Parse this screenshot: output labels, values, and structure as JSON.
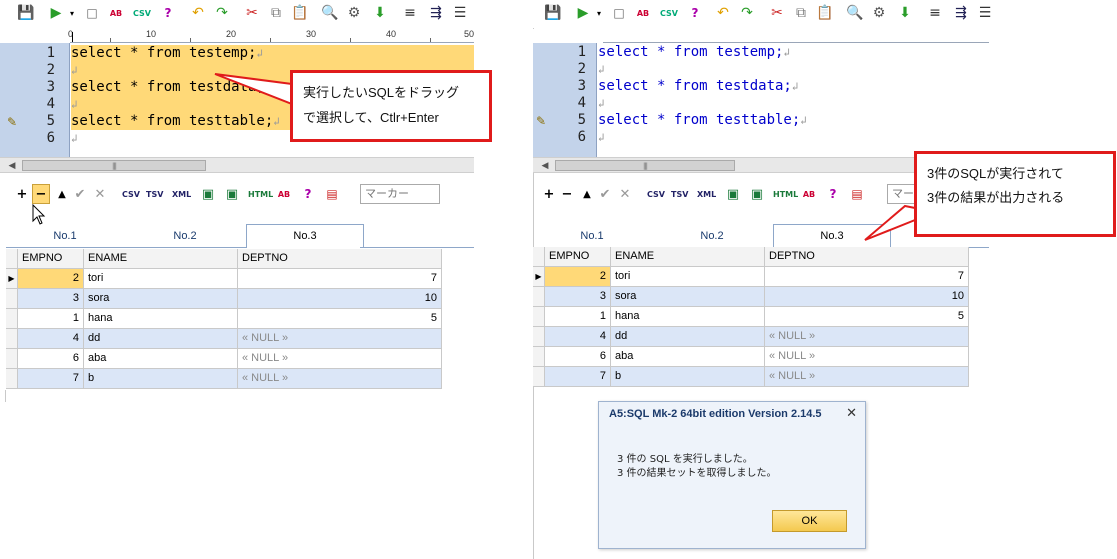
{
  "editor": {
    "lines_left": [
      {
        "num": "1",
        "code": "select * from testemp;"
      },
      {
        "num": "2",
        "code": ""
      },
      {
        "num": "3",
        "code": "select * from testdata;"
      },
      {
        "num": "4",
        "code": ""
      },
      {
        "num": "5",
        "code": "select * from testtable;"
      },
      {
        "num": "6",
        "code": ""
      }
    ],
    "eol_mark": "↲",
    "ruler_labels": [
      "0",
      "10",
      "20",
      "30",
      "40",
      "50"
    ]
  },
  "grid_toolbar": {
    "marker_placeholder": "マーカー",
    "marker_placeholder_right": "マー"
  },
  "result_tabs": [
    "No.1",
    "No.2",
    "No.3"
  ],
  "active_tab": "No.3",
  "grid": {
    "columns": [
      "EMPNO",
      "ENAME",
      "DEPTNO"
    ],
    "rows": [
      {
        "empno": "2",
        "ename": "tori",
        "deptno": "7"
      },
      {
        "empno": "3",
        "ename": "sora",
        "deptno": "10"
      },
      {
        "empno": "1",
        "ename": "hana",
        "deptno": "5"
      },
      {
        "empno": "4",
        "ename": "dd",
        "deptno": "« NULL »"
      },
      {
        "empno": "6",
        "ename": "aba",
        "deptno": "« NULL »"
      },
      {
        "empno": "7",
        "ename": "b",
        "deptno": "« NULL »"
      }
    ]
  },
  "callout_left": {
    "line1": "実行したいSQLをドラッグ",
    "line2": "で選択して、Ctlr+Enter"
  },
  "callout_right": {
    "line1": "3件のSQLが実行されて",
    "line2": "3件の結果が出力される"
  },
  "dialog": {
    "title": "A5:SQL Mk-2 64bit edition Version 2.14.5",
    "close": "✕",
    "message1": "3 件の SQL を実行しました。",
    "message2": "3 件の結果セットを取得しました。",
    "ok_label": "OK"
  },
  "colors": {
    "selection": "#ffd978",
    "gutter": "#c3d3ea",
    "callout_border": "#e01b1b",
    "row_alt": "#dbe6f7"
  }
}
